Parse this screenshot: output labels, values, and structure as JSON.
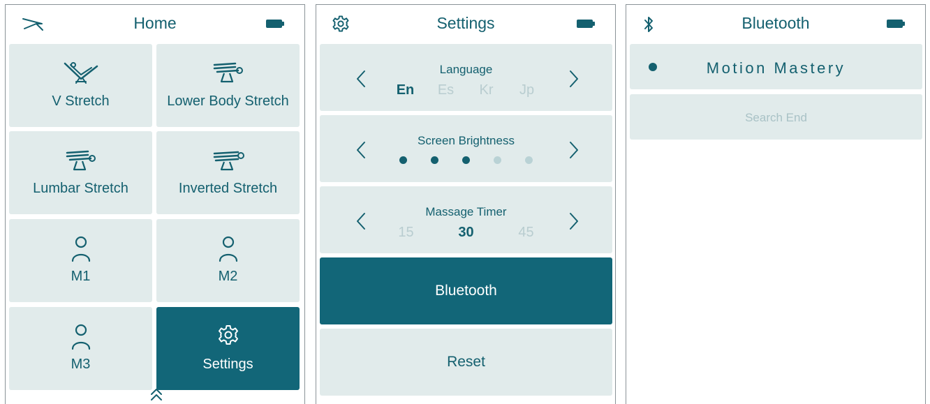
{
  "home": {
    "title": "Home",
    "tiles": [
      {
        "label": "V Stretch",
        "icon": "v-stretch-icon"
      },
      {
        "label": "Lower Body Stretch",
        "icon": "lower-body-stretch-icon"
      },
      {
        "label": "Lumbar Stretch",
        "icon": "lumbar-stretch-icon"
      },
      {
        "label": "Inverted Stretch",
        "icon": "inverted-stretch-icon"
      },
      {
        "label": "M1",
        "icon": "user-icon"
      },
      {
        "label": "M2",
        "icon": "user-icon"
      },
      {
        "label": "M3",
        "icon": "user-icon"
      },
      {
        "label": "Settings",
        "icon": "gear-icon",
        "active": true
      }
    ]
  },
  "settings": {
    "title": "Settings",
    "language": {
      "label": "Language",
      "options": [
        "En",
        "Es",
        "Kr",
        "Jp"
      ],
      "selected": "En"
    },
    "brightness": {
      "label": "Screen Brightness",
      "level": 3,
      "max": 5
    },
    "timer": {
      "label": "Massage Timer",
      "options": [
        "15",
        "30",
        "45"
      ],
      "selected": "30"
    },
    "bluetooth_label": "Bluetooth",
    "reset_label": "Reset"
  },
  "bluetooth": {
    "title": "Bluetooth",
    "devices": [
      {
        "name": "Motion Mastery",
        "connected": true
      }
    ],
    "status": "Search End"
  },
  "colors": {
    "accent": "#126678",
    "tile": "#e1ebeb",
    "text": "#14606f",
    "muted": "#b9cdd0"
  }
}
